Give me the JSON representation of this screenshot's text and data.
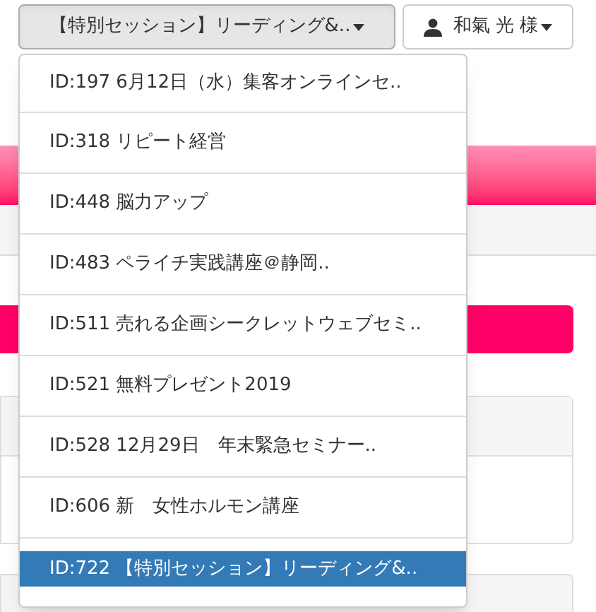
{
  "event_select": {
    "label": "【特別セッション】リーディング&..",
    "expanded": true
  },
  "user_button": {
    "label": "和氣 光 様"
  },
  "menu_items": [
    {
      "label": "ID:197 6月12日（水）集客オンラインセ..",
      "selected": false
    },
    {
      "label": "ID:318 リピート経営",
      "selected": false
    },
    {
      "label": "ID:448 脳力アップ",
      "selected": false
    },
    {
      "label": "ID:483 ペライチ実践講座＠静岡..",
      "selected": false
    },
    {
      "label": "ID:511 売れる企画シークレットウェブセミ..",
      "selected": false
    },
    {
      "label": "ID:521 無料プレゼント2019",
      "selected": false
    },
    {
      "label": "ID:528 12月29日　年末緊急セミナー..",
      "selected": false
    },
    {
      "label": "ID:606 新　女性ホルモン講座",
      "selected": false
    },
    {
      "label": "ID:722 【特別セッション】リーディング&..",
      "selected": true
    }
  ]
}
